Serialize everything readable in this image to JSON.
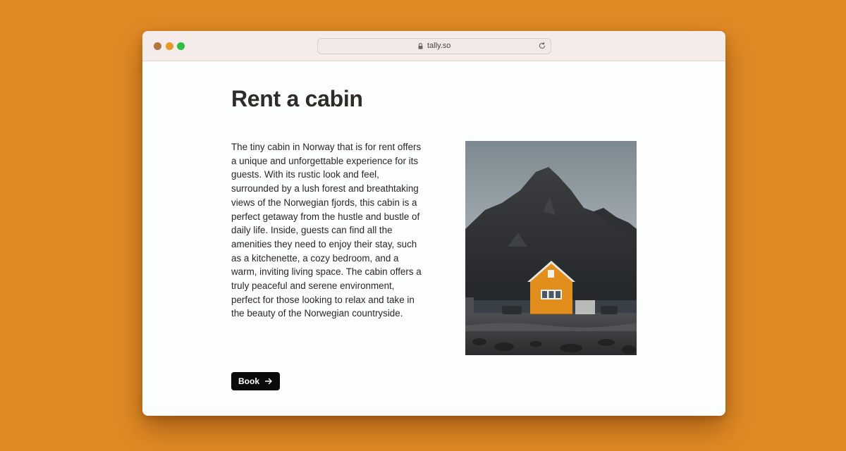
{
  "browser": {
    "url": "tally.so",
    "icons": [
      "close-dot",
      "minimize-dot",
      "maximize-dot",
      "lock-icon",
      "reload-icon"
    ]
  },
  "page": {
    "title": "Rent a cabin",
    "description": "The tiny cabin in Norway that is for rent offers a unique and unforgettable experience for its guests. With its rustic look and feel, surrounded by a lush forest and breathtaking views of the Norwegian fjords, this cabin is a perfect getaway from the hustle and bustle of daily life. Inside, guests can find all the amenities they need to enjoy their stay, such as a kitchenette, a cozy bedroom, and a warm, inviting living space. The cabin offers a truly peaceful and serene environment, perfect for those looking to relax and take in the beauty of the Norwegian countryside.",
    "book_label": "Book",
    "book_icon": "arrow-right-icon"
  },
  "colors": {
    "background": "#e08a25",
    "titlebar": "#f5ebe8",
    "button": "#0b0b0b",
    "cabin": "#e28e1c"
  }
}
